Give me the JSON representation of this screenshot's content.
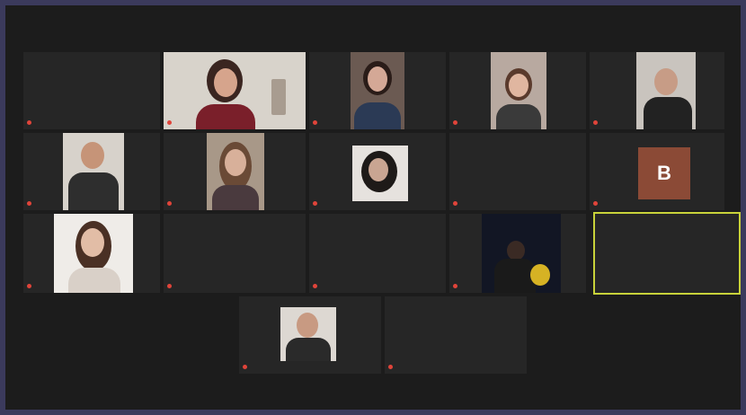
{
  "participants": [
    {
      "id": "p1",
      "label": "",
      "center_name": "",
      "kind": "blank"
    },
    {
      "id": "p2",
      "label": "",
      "center_name": "",
      "kind": "video"
    },
    {
      "id": "p3",
      "label": "",
      "center_name": "",
      "kind": "video"
    },
    {
      "id": "p4",
      "label": "",
      "center_name": "",
      "kind": "video"
    },
    {
      "id": "p5",
      "label": "",
      "center_name": "",
      "kind": "video"
    },
    {
      "id": "p6",
      "label": "",
      "center_name": "",
      "kind": "video"
    },
    {
      "id": "p7",
      "label": "",
      "center_name": "",
      "kind": "video"
    },
    {
      "id": "p8",
      "label": "",
      "center_name": "",
      "kind": "video"
    },
    {
      "id": "p9",
      "label": "",
      "center_name": "",
      "kind": "name"
    },
    {
      "id": "p10",
      "label": "",
      "center_name": "",
      "kind": "avatar",
      "avatar_letter": "B"
    },
    {
      "id": "p11",
      "label": "",
      "center_name": "",
      "kind": "video"
    },
    {
      "id": "p12",
      "label": "",
      "center_name": "",
      "kind": "name"
    },
    {
      "id": "p13",
      "label": "",
      "center_name": "",
      "kind": "name"
    },
    {
      "id": "p14",
      "label": "",
      "center_name": "",
      "kind": "video"
    },
    {
      "id": "p15",
      "label": "",
      "center_name": "",
      "kind": "name",
      "active": true
    },
    {
      "id": "p16",
      "label": "",
      "center_name": "",
      "kind": "video"
    },
    {
      "id": "p17",
      "label": "",
      "center_name": "",
      "kind": "name"
    }
  ],
  "status_note": "",
  "colors": {
    "active_outline": "#c8d23a",
    "mic_muted": "#e0443a",
    "tile_bg": "#262626",
    "page_bg": "#3b3a5c"
  }
}
